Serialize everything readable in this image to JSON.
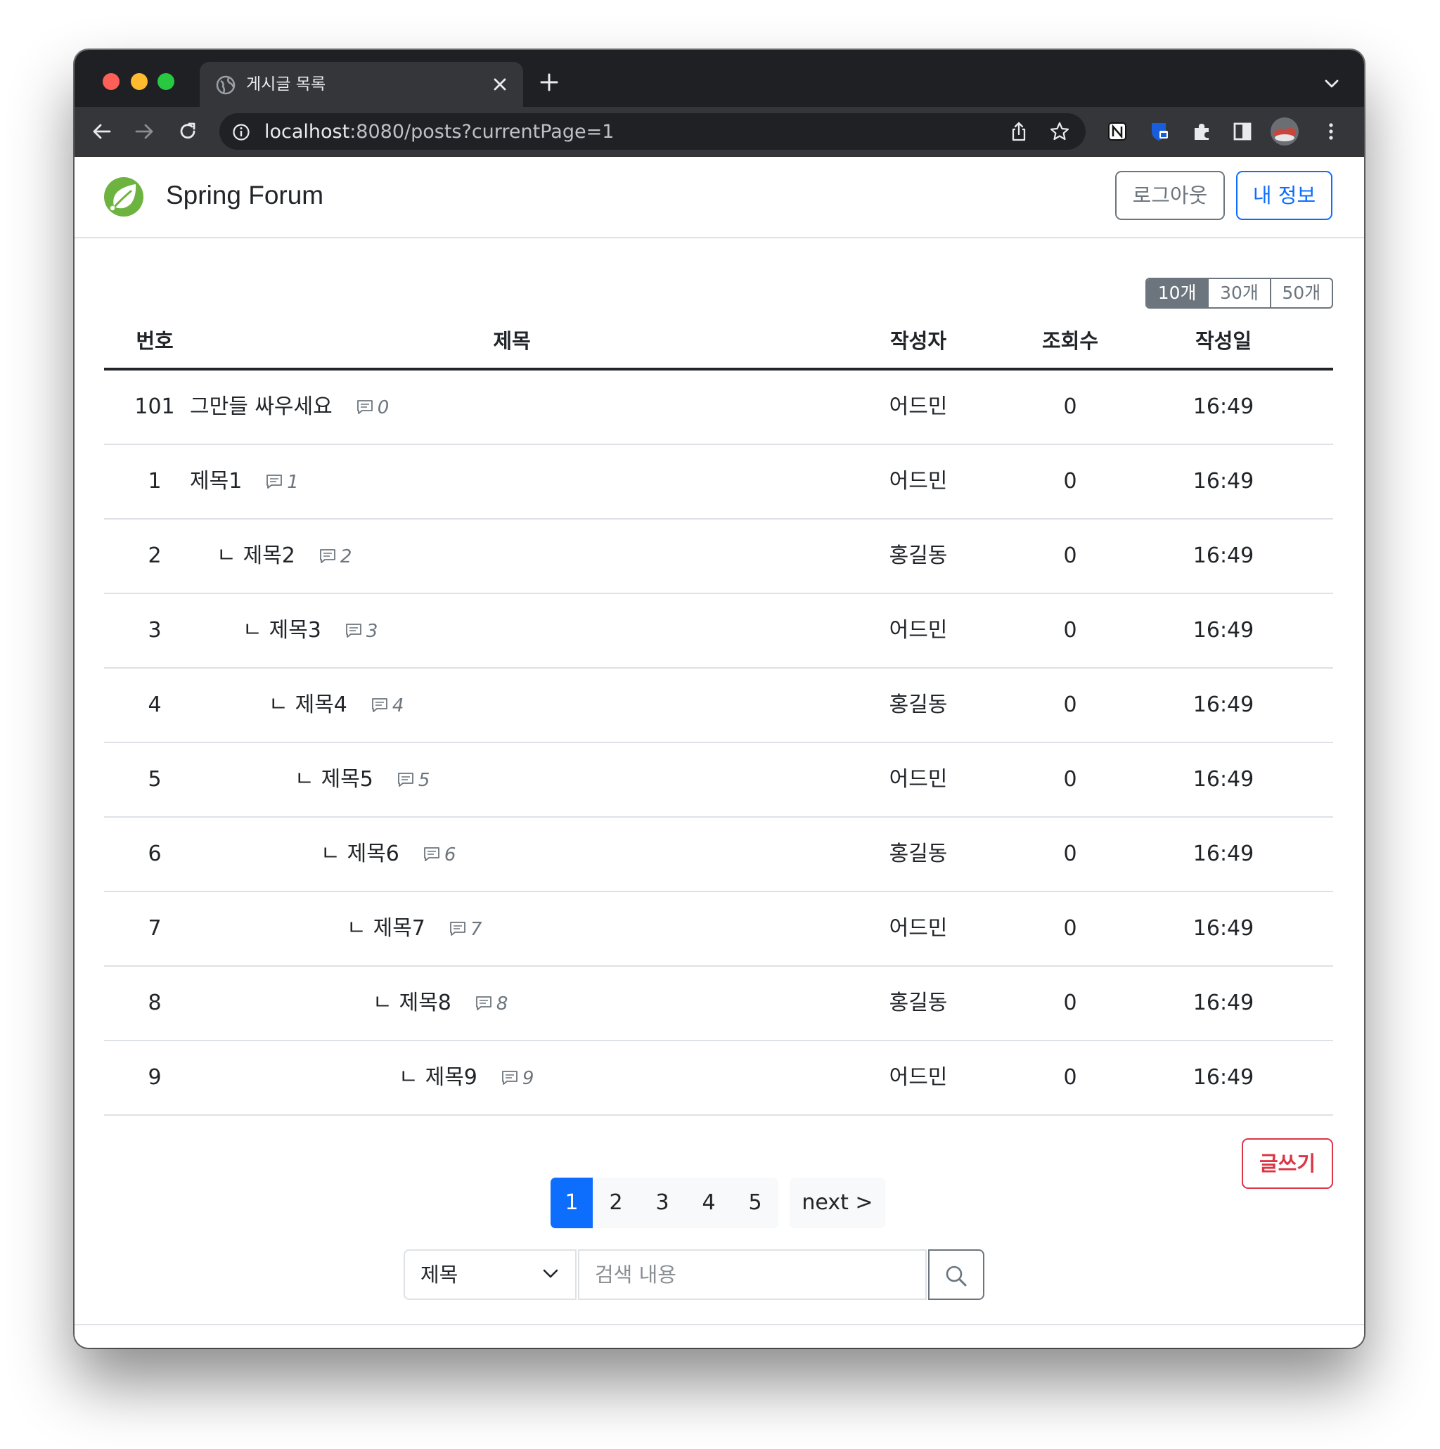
{
  "browser": {
    "tab_title": "게시글 목록",
    "url_host": "localhost",
    "url_rest": ":8080/posts?currentPage=1"
  },
  "header": {
    "brand": "Spring Forum",
    "logout_label": "로그아웃",
    "myinfo_label": "내 정보"
  },
  "page_size": {
    "options": [
      "10개",
      "30개",
      "50개"
    ],
    "selected": "10개"
  },
  "table": {
    "headers": [
      "번호",
      "제목",
      "작성자",
      "조회수",
      "작성일"
    ],
    "reply_marker": "ㄴ",
    "rows": [
      {
        "no": "101",
        "title": "그만들 싸우세요",
        "comments": "0",
        "author": "어드민",
        "views": "0",
        "date": "16:49",
        "depth": 0
      },
      {
        "no": "1",
        "title": "제목1",
        "comments": "1",
        "author": "어드민",
        "views": "0",
        "date": "16:49",
        "depth": 0
      },
      {
        "no": "2",
        "title": "제목2",
        "comments": "2",
        "author": "홍길동",
        "views": "0",
        "date": "16:49",
        "depth": 1
      },
      {
        "no": "3",
        "title": "제목3",
        "comments": "3",
        "author": "어드민",
        "views": "0",
        "date": "16:49",
        "depth": 2
      },
      {
        "no": "4",
        "title": "제목4",
        "comments": "4",
        "author": "홍길동",
        "views": "0",
        "date": "16:49",
        "depth": 3
      },
      {
        "no": "5",
        "title": "제목5",
        "comments": "5",
        "author": "어드민",
        "views": "0",
        "date": "16:49",
        "depth": 4
      },
      {
        "no": "6",
        "title": "제목6",
        "comments": "6",
        "author": "홍길동",
        "views": "0",
        "date": "16:49",
        "depth": 5
      },
      {
        "no": "7",
        "title": "제목7",
        "comments": "7",
        "author": "어드민",
        "views": "0",
        "date": "16:49",
        "depth": 6
      },
      {
        "no": "8",
        "title": "제목8",
        "comments": "8",
        "author": "홍길동",
        "views": "0",
        "date": "16:49",
        "depth": 7
      },
      {
        "no": "9",
        "title": "제목9",
        "comments": "9",
        "author": "어드민",
        "views": "0",
        "date": "16:49",
        "depth": 8
      }
    ]
  },
  "write_label": "글쓰기",
  "pagination": {
    "pages": [
      "1",
      "2",
      "3",
      "4",
      "5"
    ],
    "current": "1",
    "next_label": "next >"
  },
  "search": {
    "field_selected": "제목",
    "placeholder": "검색 내용"
  },
  "colors": {
    "primary": "#0d6efd",
    "secondary": "#6c757d",
    "danger": "#dc3545",
    "brand_green": "#6db33f"
  }
}
